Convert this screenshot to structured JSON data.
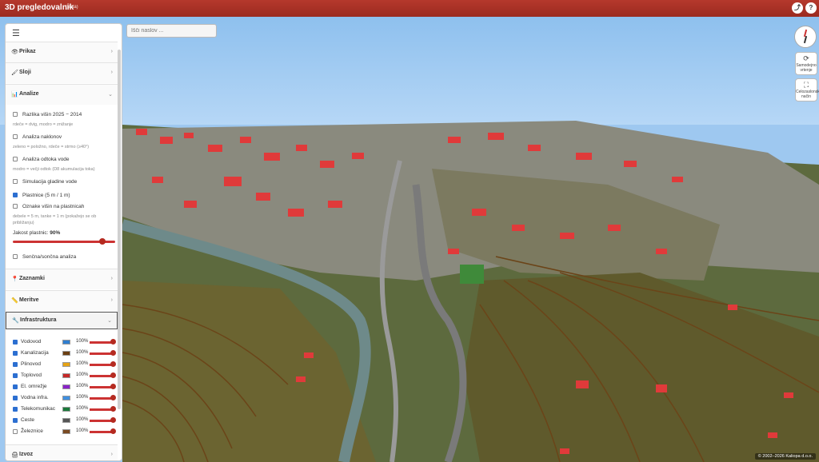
{
  "app": {
    "title": "3D pregledovalnik",
    "beta": "(beta)"
  },
  "search": {
    "placeholder": "Išči naslov ..."
  },
  "topbar": {
    "share_icon": "share-icon",
    "help_label": "?"
  },
  "panel": {
    "sections": {
      "prikaz": "Prikaz",
      "sloji": "Sloji",
      "analize": "Analize",
      "zaznamki": "Zaznamki",
      "meritve": "Meritve",
      "infrastruktura": "Infrastruktura",
      "izvoz": "Izvoz"
    },
    "analyses": [
      {
        "label": "Razlika višin 2025 − 2014",
        "checked": false,
        "hint": "rdeče = dvig, modro = znižanje"
      },
      {
        "label": "Analiza naklonov",
        "checked": false,
        "hint": "zeleno = položno, rdeče = strmo (≥40°)"
      },
      {
        "label": "Analiza odtoka vode",
        "checked": false,
        "hint": "modro = večji odtok (D8 akumulacija toka)"
      },
      {
        "label": "Simulacija gladine vode",
        "checked": false,
        "hint": ""
      },
      {
        "label": "Plastnice (5 m / 1 m)",
        "checked": true,
        "hint": ""
      },
      {
        "label": "Oznake višin na plastnicah",
        "checked": false,
        "hint": "debele = 5 m, tanke = 1 m (pokažejo se ob približanju)"
      }
    ],
    "quality_label": "Jakost plastnic:",
    "quality_value": "90%",
    "quality_fraction": 0.9,
    "shadow_label": "Senčna/sončna analiza",
    "infra": [
      {
        "name": "Vodovod",
        "color": "#2f7fd1",
        "pct": "100%",
        "checked": true
      },
      {
        "name": "Kanalizacija",
        "color": "#6b3f12",
        "pct": "100%",
        "checked": true
      },
      {
        "name": "Plinovod",
        "color": "#e6a314",
        "pct": "100%",
        "checked": true
      },
      {
        "name": "Toplovod",
        "color": "#c62828",
        "pct": "100%",
        "checked": true
      },
      {
        "name": "El. omrežje",
        "color": "#8a23c8",
        "pct": "100%",
        "checked": true
      },
      {
        "name": "Vodna infra.",
        "color": "#3f8fe0",
        "pct": "100%",
        "checked": true
      },
      {
        "name": "Telekomunikac",
        "color": "#1a7a3a",
        "pct": "100%",
        "checked": true
      },
      {
        "name": "Ceste",
        "color": "#555555",
        "pct": "100%",
        "checked": true
      },
      {
        "name": "Železnice",
        "color": "#7a4a22",
        "pct": "100%",
        "checked": false
      }
    ]
  },
  "controls": {
    "reset_label": "Samodejno vrtenje",
    "fullscreen_label": "Celozaslonski način"
  },
  "copyright": "© 2002–2026 Kaliopa d.o.o."
}
